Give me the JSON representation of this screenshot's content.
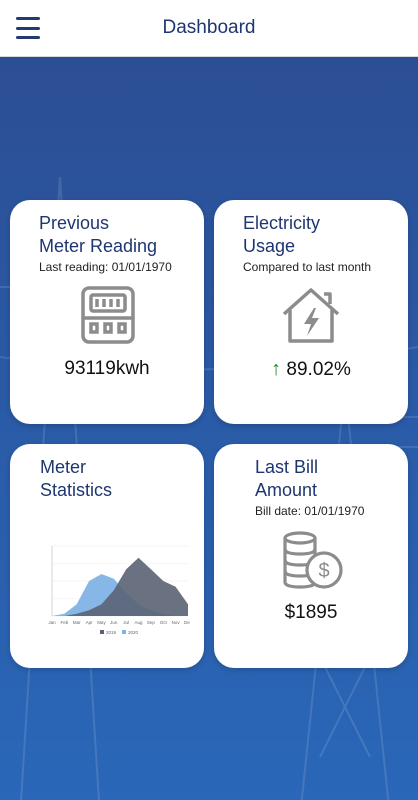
{
  "header": {
    "title": "Dashboard",
    "menu_icon": "hamburger-menu-icon"
  },
  "cards": {
    "previous_meter": {
      "title_line1": "Previous",
      "title_line2": "Meter Reading",
      "subtitle": "Last reading: 01/01/1970",
      "value": "93119kwh",
      "icon": "electric-meter-icon"
    },
    "electricity_usage": {
      "title_line1": "Electricity",
      "title_line2": "Usage",
      "subtitle": "Compared to last month",
      "value": "89.02%",
      "trend_icon": "arrow-up-icon",
      "trend_color": "#1f8a2e",
      "icon": "house-lightning-icon"
    },
    "meter_statistics": {
      "title_line1": "Meter",
      "title_line2": "Statistics",
      "icon": "area-chart-thumbnail"
    },
    "last_bill": {
      "title_line1": "Last Bill",
      "title_line2": "Amount",
      "subtitle": "Bill date: 01/01/1970",
      "value": "$1895",
      "icon": "coins-dollar-icon"
    }
  },
  "chart_data": {
    "type": "area",
    "categories": [
      "Jan",
      "Feb",
      "Mar",
      "Apr",
      "May",
      "Jun",
      "Jul",
      "Aug",
      "Sep",
      "Oct",
      "Nov",
      "Dec"
    ],
    "series": [
      {
        "name": "2019",
        "values": [
          0,
          0,
          2,
          5,
          10,
          22,
          40,
          50,
          40,
          30,
          25,
          10
        ]
      },
      {
        "name": "2020",
        "values": [
          0,
          2,
          10,
          30,
          36,
          32,
          20,
          10,
          5,
          2,
          0,
          0
        ]
      }
    ],
    "legend_position": "bottom",
    "colors": {
      "2019": "#5a6374",
      "2020": "#7fb3e6"
    },
    "ylim": [
      0,
      60
    ]
  },
  "colors": {
    "accent": "#1e3670",
    "background": "#2b4f96",
    "card": "#ffffff",
    "icon_gray": "#8c8c8c"
  }
}
